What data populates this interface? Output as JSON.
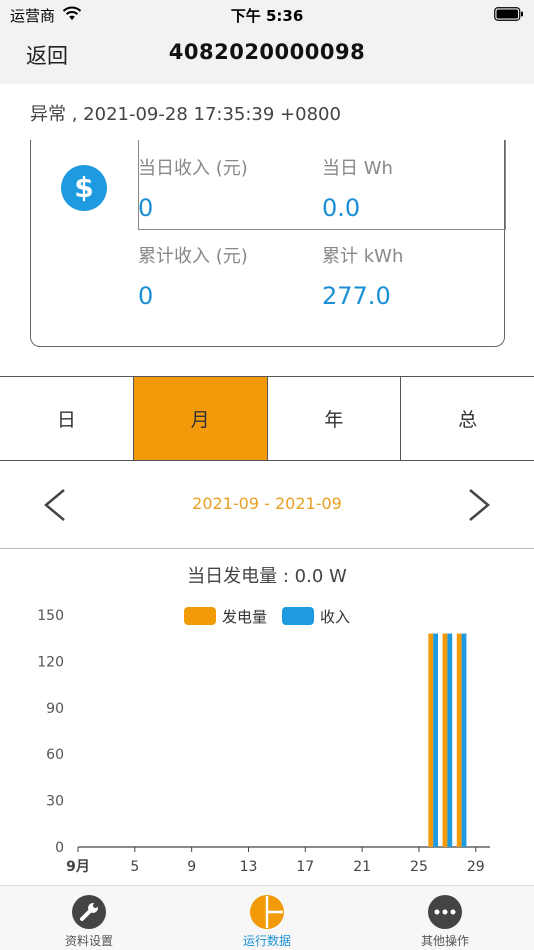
{
  "status_bar": {
    "carrier": "运营商",
    "time": "下午 5:36"
  },
  "nav": {
    "back_label": "返回",
    "title": "4082020000098"
  },
  "device_status": "异常 , 2021-09-28 17:35:39 +0800",
  "summary": {
    "daily_income_label": "当日收入 (元)",
    "daily_income_value": "0",
    "daily_energy_label": "当日 Wh",
    "daily_energy_value": "0.0",
    "total_income_label": "累计收入 (元)",
    "total_income_value": "0",
    "total_energy_label": "累计 kWh",
    "total_energy_value": "277.0"
  },
  "period_tabs": [
    {
      "label": "日",
      "active": false
    },
    {
      "label": "月",
      "active": true
    },
    {
      "label": "年",
      "active": false
    },
    {
      "label": "总",
      "active": false
    }
  ],
  "date_range": "2021-09 - 2021-09",
  "chart_data": {
    "type": "bar",
    "title": "当日发电量 : 0.0 W",
    "x_tick_labels": [
      "9月",
      "5",
      "9",
      "13",
      "17",
      "21",
      "25",
      "29"
    ],
    "x_ticks": [
      1,
      5,
      9,
      13,
      17,
      21,
      25,
      29
    ],
    "xlim": [
      1,
      30
    ],
    "y_ticks": [
      0,
      30,
      60,
      90,
      120,
      150
    ],
    "ylim": [
      0,
      150
    ],
    "x": [
      26,
      27,
      28
    ],
    "series": [
      {
        "name": "发电量",
        "color": "#f29a0a",
        "values": [
          138,
          138,
          138
        ]
      },
      {
        "name": "收入",
        "color": "#1e9be0",
        "values": [
          138,
          138,
          138
        ]
      }
    ],
    "legend": "top-center"
  },
  "tab_bar": [
    {
      "label": "资料设置",
      "icon": "wrench-icon",
      "active": false
    },
    {
      "label": "运行数据",
      "icon": "pie-chart-icon",
      "active": true
    },
    {
      "label": "其他操作",
      "icon": "more-icon",
      "active": false
    }
  ],
  "colors": {
    "accent": "#f29a0a",
    "blue": "#1a8fd6"
  }
}
